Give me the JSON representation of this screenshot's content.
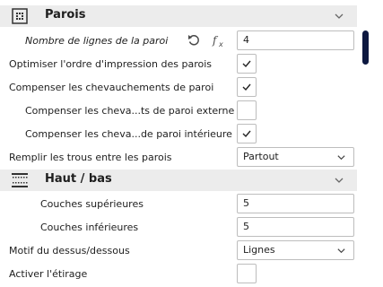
{
  "walls": {
    "title": "Parois",
    "line_count": {
      "label": "Nombre de lignes de la paroi",
      "value": "4"
    },
    "optimize_order": {
      "label": "Optimiser l'ordre d'impression des parois",
      "checked": true
    },
    "compensate_overlaps": {
      "label": "Compenser les chevauchements de paroi",
      "checked": true
    },
    "compensate_outer": {
      "label": "Compenser les cheva...ts de paroi externe",
      "checked": false
    },
    "compensate_inner": {
      "label": "Compenser les cheva...de paroi intérieure",
      "checked": true
    },
    "fill_gaps": {
      "label": "Remplir les trous entre les parois",
      "value": "Partout"
    }
  },
  "top_bottom": {
    "title": "Haut / bas",
    "top_layers": {
      "label": "Couches supérieures",
      "value": "5"
    },
    "bottom_layers": {
      "label": "Couches inférieures",
      "value": "5"
    },
    "pattern": {
      "label": "Motif du dessus/dessous",
      "value": "Lignes"
    },
    "ironing": {
      "label": "Activer l'étirage",
      "checked": false
    }
  },
  "icons": {
    "reset": "reset-icon",
    "function": "function-icon",
    "walls_section": "walls-grid-icon",
    "top_bottom_section": "top-bottom-icon"
  },
  "colors": {
    "section_bg": "#ececec",
    "scrollbar": "#0d1840",
    "checkmark": "#222222"
  }
}
